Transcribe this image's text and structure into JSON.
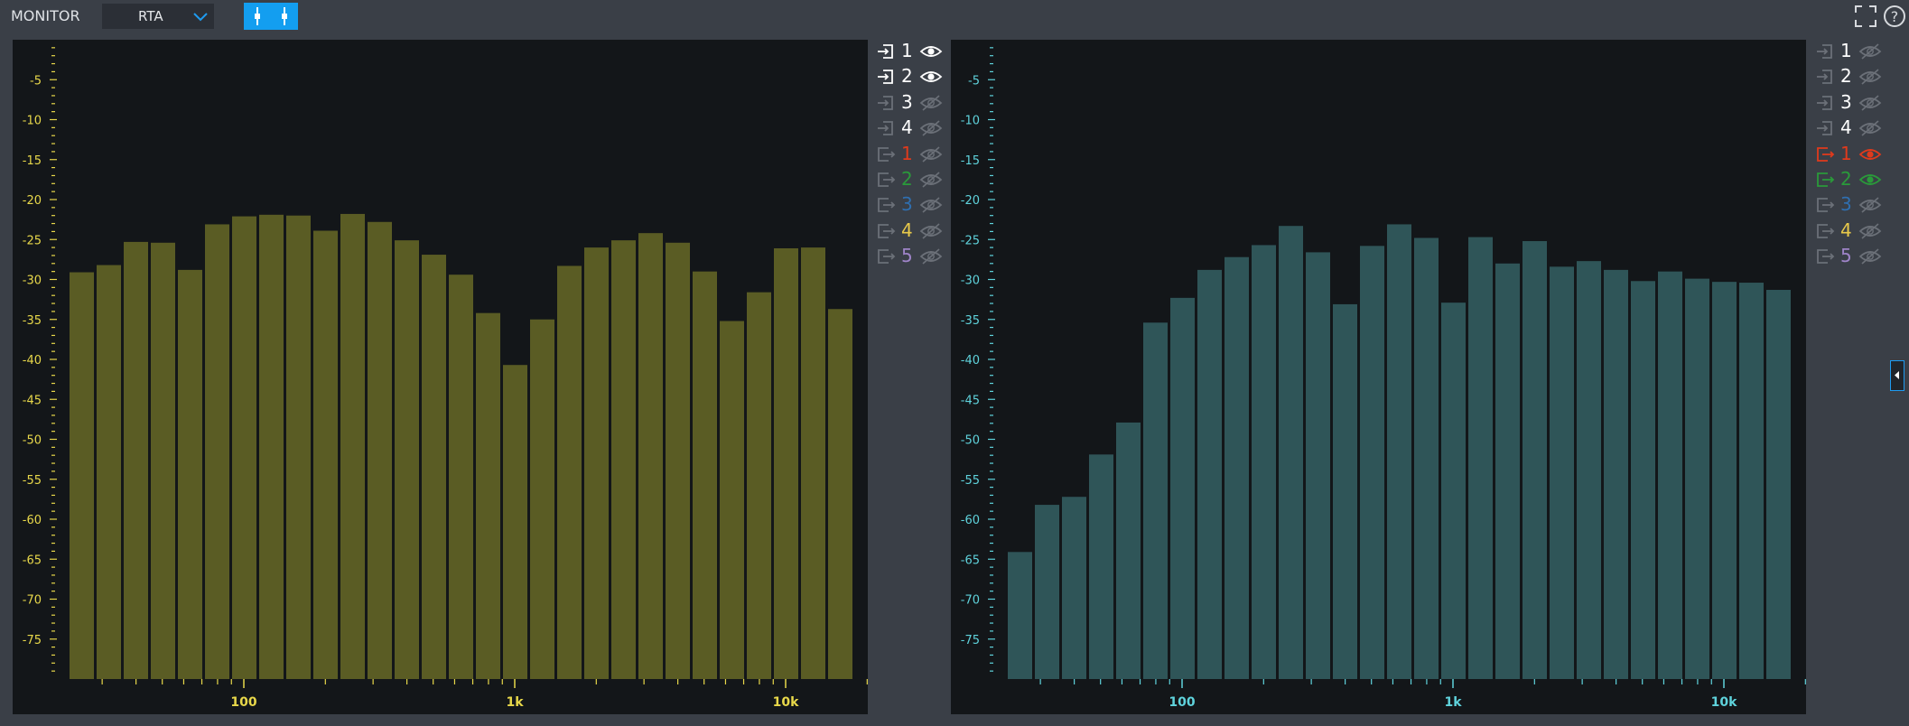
{
  "topbar": {
    "monitor_label": "MONITOR",
    "mode_value": "RTA",
    "fullscreen_icon": "fullscreen-icon",
    "help_icon": "help-icon",
    "link_icon": "link-icon"
  },
  "colors": {
    "left_bar": "#5a5c24",
    "right_bar": "#2f5558",
    "left_axis": "#e8d84a",
    "right_axis": "#5fd3dc",
    "out1": "#e03a1c",
    "out2": "#2a9a3a",
    "out3": "#2f6fb0",
    "out4": "#e8c94a",
    "out5": "#9f84c8",
    "in": "#ffffff",
    "dim": "#6b7078",
    "accent": "#139ef0"
  },
  "left_legend": [
    {
      "type": "in",
      "label": "1",
      "visible": true,
      "color": "#ffffff"
    },
    {
      "type": "in",
      "label": "2",
      "visible": true,
      "color": "#ffffff"
    },
    {
      "type": "in",
      "label": "3",
      "visible": false,
      "color": "#ffffff"
    },
    {
      "type": "in",
      "label": "4",
      "visible": false,
      "color": "#ffffff"
    },
    {
      "type": "out",
      "label": "1",
      "visible": false,
      "color": "#e03a1c"
    },
    {
      "type": "out",
      "label": "2",
      "visible": false,
      "color": "#2a9a3a"
    },
    {
      "type": "out",
      "label": "3",
      "visible": false,
      "color": "#2f6fb0"
    },
    {
      "type": "out",
      "label": "4",
      "visible": false,
      "color": "#e8c94a"
    },
    {
      "type": "out",
      "label": "5",
      "visible": false,
      "color": "#9f84c8"
    }
  ],
  "right_legend": [
    {
      "type": "in",
      "label": "1",
      "visible": false,
      "color": "#ffffff"
    },
    {
      "type": "in",
      "label": "2",
      "visible": false,
      "color": "#ffffff"
    },
    {
      "type": "in",
      "label": "3",
      "visible": false,
      "color": "#ffffff"
    },
    {
      "type": "in",
      "label": "4",
      "visible": false,
      "color": "#ffffff"
    },
    {
      "type": "out",
      "label": "1",
      "visible": true,
      "color": "#e03a1c"
    },
    {
      "type": "out",
      "label": "2",
      "visible": true,
      "color": "#2a9a3a"
    },
    {
      "type": "out",
      "label": "3",
      "visible": false,
      "color": "#2f6fb0"
    },
    {
      "type": "out",
      "label": "4",
      "visible": false,
      "color": "#e8c94a"
    },
    {
      "type": "out",
      "label": "5",
      "visible": false,
      "color": "#9f84c8"
    }
  ],
  "chart_data": [
    {
      "type": "bar",
      "ylim": [
        -80,
        0
      ],
      "yticks": [
        "-5",
        "-10",
        "-15",
        "-20",
        "-25",
        "-30",
        "-35",
        "-40",
        "-45",
        "-50",
        "-55",
        "-60",
        "-65",
        "-70",
        "-75"
      ],
      "xticks": [
        "100",
        "1k",
        "10k"
      ],
      "values": [
        -29.1,
        -28.2,
        -25.3,
        -25.4,
        -28.8,
        -23.1,
        -22.1,
        -21.9,
        -22.0,
        -23.9,
        -21.8,
        -22.8,
        -25.1,
        -26.9,
        -29.4,
        -34.2,
        -40.7,
        -35.0,
        -28.3,
        -26.0,
        -25.1,
        -24.2,
        -25.4,
        -29.0,
        -35.2,
        -31.6,
        -26.1,
        -26.0,
        -33.7
      ],
      "grid": false
    },
    {
      "type": "bar",
      "ylim": [
        -80,
        0
      ],
      "yticks": [
        "-5",
        "-10",
        "-15",
        "-20",
        "-25",
        "-30",
        "-35",
        "-40",
        "-45",
        "-50",
        "-55",
        "-60",
        "-65",
        "-70",
        "-75"
      ],
      "xticks": [
        "100",
        "1k",
        "10k"
      ],
      "values": [
        -64.1,
        -58.2,
        -57.2,
        -51.9,
        -47.9,
        -35.4,
        -32.3,
        -28.8,
        -27.2,
        -25.7,
        -23.3,
        -26.6,
        -33.1,
        -25.8,
        -23.1,
        -24.8,
        -32.9,
        -24.7,
        -28.0,
        -25.2,
        -28.4,
        -27.7,
        -28.8,
        -30.2,
        -29.0,
        -29.9,
        -30.3,
        -30.4,
        -31.3
      ],
      "grid": false
    }
  ]
}
